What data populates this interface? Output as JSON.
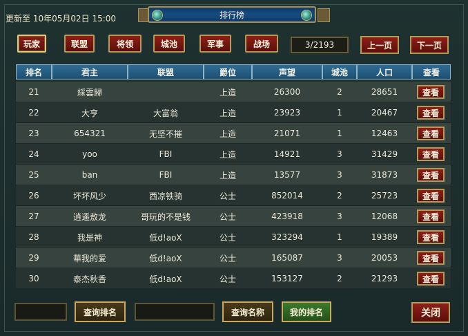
{
  "update": {
    "label": "更新至",
    "datetime": "10年05月02日 15:00"
  },
  "title": "排行榜",
  "tabs": [
    {
      "label": "玩家",
      "active": true
    },
    {
      "label": "联盟",
      "active": false
    },
    {
      "label": "将领",
      "active": false
    },
    {
      "label": "城池",
      "active": false
    },
    {
      "label": "军事",
      "active": false
    },
    {
      "label": "战场",
      "active": false
    }
  ],
  "pagination": {
    "indicator": "3/2193",
    "prev_label": "上一页",
    "next_label": "下一页"
  },
  "table": {
    "columns": [
      "排名",
      "君主",
      "联盟",
      "爵位",
      "声望",
      "城池",
      "人口",
      "查看"
    ],
    "view_label": "查看",
    "rows": [
      {
        "rank": "21",
        "lord": "綵雲歸",
        "alliance": "",
        "title": "上造",
        "prestige": "26300",
        "cities": "2",
        "population": "28651"
      },
      {
        "rank": "22",
        "lord": "大亨",
        "alliance": "大富翁",
        "title": "上造",
        "prestige": "23923",
        "cities": "1",
        "population": "20467"
      },
      {
        "rank": "23",
        "lord": "654321",
        "alliance": "无坚不摧",
        "title": "上造",
        "prestige": "21071",
        "cities": "1",
        "population": "12463"
      },
      {
        "rank": "24",
        "lord": "yoo",
        "alliance": "FBI",
        "title": "上造",
        "prestige": "14921",
        "cities": "3",
        "population": "31429"
      },
      {
        "rank": "25",
        "lord": "ban",
        "alliance": "FBI",
        "title": "上造",
        "prestige": "13577",
        "cities": "3",
        "population": "31873"
      },
      {
        "rank": "26",
        "lord": "坏坏风少",
        "alliance": "西凉铁骑",
        "title": "公士",
        "prestige": "852014",
        "cities": "2",
        "population": "25723"
      },
      {
        "rank": "27",
        "lord": "逍遥敖龙",
        "alliance": "哥玩的不是钱",
        "title": "公士",
        "prestige": "423918",
        "cities": "3",
        "population": "12068"
      },
      {
        "rank": "28",
        "lord": "我是神",
        "alliance": "低d!aoX",
        "title": "公士",
        "prestige": "323294",
        "cities": "1",
        "population": "19389"
      },
      {
        "rank": "29",
        "lord": "華我的爱",
        "alliance": "低d!aoX",
        "title": "公士",
        "prestige": "165087",
        "cities": "3",
        "population": "20053"
      },
      {
        "rank": "30",
        "lord": "泰杰秋香",
        "alliance": "低d!aoX",
        "title": "公士",
        "prestige": "153127",
        "cities": "2",
        "population": "21293"
      }
    ]
  },
  "footer": {
    "rank_input_value": "",
    "query_rank_label": "查询排名",
    "name_input_value": "",
    "query_name_label": "查询名称",
    "my_rank_label": "我的排名",
    "close_label": "关闭"
  },
  "colors": {
    "tab_red": "#7a1a14",
    "header_blue": "#2a6088",
    "gold_border": "#b39b5a",
    "my_rank_green": "#3d7a2a"
  }
}
